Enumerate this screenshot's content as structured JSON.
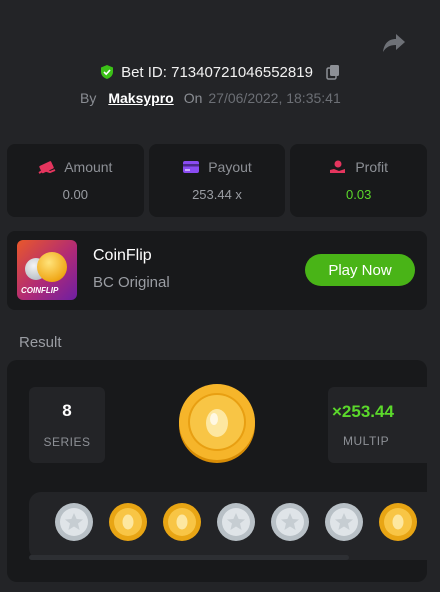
{
  "header": {
    "bet_id": "Bet ID: 71340721046552819",
    "by_label": "By",
    "username": "Maksypro",
    "on_label": "On",
    "date": "27/06/2022, 18:35:41"
  },
  "stats": [
    {
      "label": "Amount",
      "value": "0.00",
      "icon": "money-icon"
    },
    {
      "label": "Payout",
      "value": "253.44 x",
      "icon": "card-icon"
    },
    {
      "label": "Profit",
      "value": "0.03",
      "icon": "profit-hand-icon"
    }
  ],
  "game": {
    "thumb_label": "COINFLIP",
    "name": "CoinFlip",
    "subtitle": "BC Original",
    "play_label": "Play Now"
  },
  "result": {
    "title": "Result",
    "series_value": "8",
    "series_label": "SERIES",
    "multiplier_value": "×253.44",
    "multiplier_label": "MULTIP",
    "coins": [
      "silver",
      "gold",
      "gold",
      "silver",
      "silver",
      "silver",
      "gold"
    ]
  },
  "colors": {
    "background": "#232427",
    "card": "#18191b",
    "accent_green": "#49b417",
    "profit_green": "#5bd82b",
    "gold": "#f0a818",
    "silver": "#c4cbd1"
  }
}
